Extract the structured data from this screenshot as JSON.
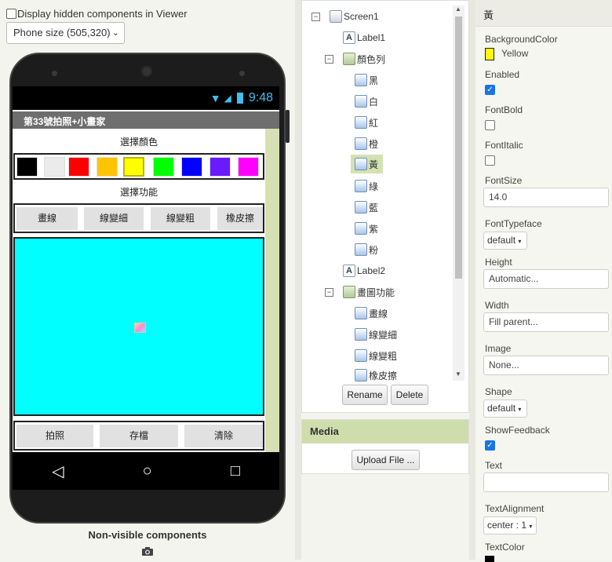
{
  "viewer": {
    "hidden_toggle_label": "Display hidden components in Viewer",
    "phone_size": "Phone size (505,320)",
    "status_time": "9:48",
    "app_title": "第33號拍照+小畫家",
    "label_select_color": "選擇顏色",
    "label_select_function": "選擇功能",
    "colors": [
      "#000000",
      "#ebebeb",
      "#ff0000",
      "#ffc400",
      "#ffff00",
      "#00ff00",
      "#0000ff",
      "#6a1aff",
      "#ff00ff"
    ],
    "selected_color_index": 4,
    "function_buttons": [
      "畫線",
      "線變細",
      "線變粗",
      "橡皮擦"
    ],
    "bottom_buttons": [
      "拍照",
      "存檔",
      "清除"
    ],
    "non_visible_label": "Non-visible components"
  },
  "tree": {
    "screen": "Screen1",
    "label1": "Label1",
    "color_arrangement": "顏色列",
    "color_items": [
      "黑",
      "白",
      "紅",
      "橙",
      "黃",
      "綠",
      "藍",
      "紫",
      "粉"
    ],
    "selected_item": "黃",
    "label2": "Label2",
    "func_arrangement": "畫圖功能",
    "func_items": [
      "畫線",
      "線變細",
      "線變粗",
      "橡皮擦"
    ],
    "rename_label": "Rename",
    "delete_label": "Delete"
  },
  "media": {
    "title": "Media",
    "upload_label": "Upload File ..."
  },
  "properties": {
    "component_name": "黃",
    "background_color_label": "BackgroundColor",
    "background_color_value": "Yellow",
    "enabled_label": "Enabled",
    "enabled": true,
    "font_bold_label": "FontBold",
    "font_bold": false,
    "font_italic_label": "FontItalic",
    "font_italic": false,
    "font_size_label": "FontSize",
    "font_size_value": "14.0",
    "font_typeface_label": "FontTypeface",
    "font_typeface_value": "default",
    "height_label": "Height",
    "height_value": "Automatic...",
    "width_label": "Width",
    "width_value": "Fill parent...",
    "image_label": "Image",
    "image_value": "None...",
    "shape_label": "Shape",
    "shape_value": "default",
    "show_feedback_label": "ShowFeedback",
    "show_feedback": true,
    "text_label": "Text",
    "text_value": "",
    "text_alignment_label": "TextAlignment",
    "text_alignment_value": "center : 1",
    "text_color_label": "TextColor"
  }
}
